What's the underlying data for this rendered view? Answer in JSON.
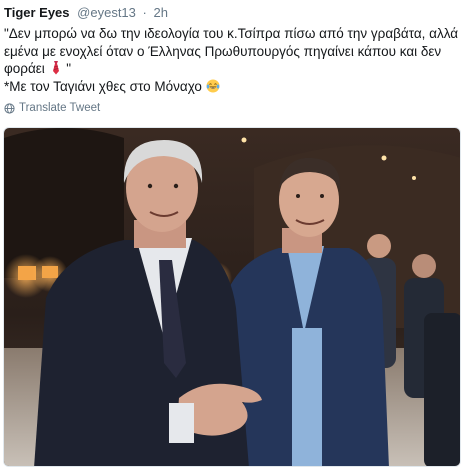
{
  "tweet": {
    "display_name": "Tiger Eyes",
    "handle": "@eyest13",
    "separator": "·",
    "time": "2h",
    "text_line1": "\"Δεν μπορώ να δω την ιδεολογία του κ.Τσίπρα πίσω από την γραβάτα, αλλά",
    "text_line2": "εμένα με ενοχλεί όταν ο Έλληνας Πρωθυπουργός πηγαίνει κάπου και δεν",
    "text_line3_pre": "φοράει",
    "text_line3_post": " \"",
    "text_line4": "*Με τον Ταγιάνι χθες στο Μόναχο",
    "emoji_tie": "necktie-emoji",
    "emoji_laugh": "laughing-tears-emoji",
    "translate_label": "Translate Tweet",
    "translate_icon": "globe-icon"
  },
  "media": {
    "description_icon": "photo",
    "colors": {
      "background": "#2a1f1a",
      "suit_dark": "#1e2230",
      "suit_blue": "#25365a",
      "shirt_light": "#e6e8ec",
      "shirt_blue": "#8fb3da",
      "skin": "#d7a890",
      "floor": "#c9c1b8"
    }
  },
  "colors": {
    "text": "#14171a",
    "secondary": "#657786",
    "border": "#e1e8ed"
  }
}
